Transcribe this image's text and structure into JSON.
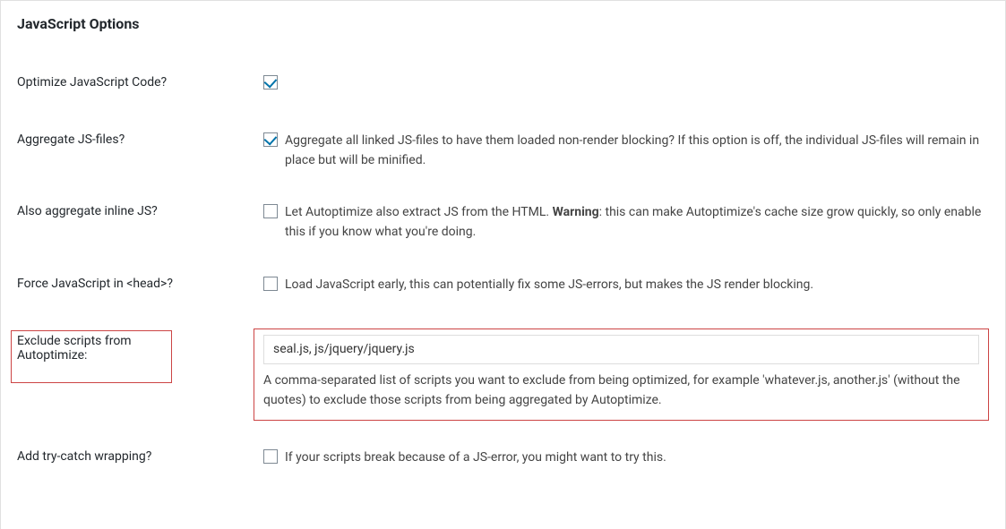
{
  "section": {
    "title": "JavaScript Options"
  },
  "rows": {
    "optimize": {
      "label": "Optimize JavaScript Code?",
      "checked": true
    },
    "aggregate": {
      "label": "Aggregate JS-files?",
      "checked": true,
      "desc": "Aggregate all linked JS-files to have them loaded non-render blocking? If this option is off, the individual JS-files will remain in place but will be minified."
    },
    "inline": {
      "label": "Also aggregate inline JS?",
      "checked": false,
      "desc_pre": "Let Autoptimize also extract JS from the HTML. ",
      "desc_bold": "Warning",
      "desc_post": ": this can make Autoptimize's cache size grow quickly, so only enable this if you know what you're doing."
    },
    "forcehead": {
      "label": "Force JavaScript in <head>?",
      "checked": false,
      "desc": "Load JavaScript early, this can potentially fix some JS-errors, but makes the JS render blocking."
    },
    "exclude": {
      "label": "Exclude scripts from Autoptimize:",
      "value": "seal.js, js/jquery/jquery.js",
      "hint": "A comma-separated list of scripts you want to exclude from being optimized, for example 'whatever.js, another.js' (without the quotes) to exclude those scripts from being aggregated by Autoptimize."
    },
    "trycatch": {
      "label": "Add try-catch wrapping?",
      "checked": false,
      "desc": "If your scripts break because of a JS-error, you might want to try this."
    }
  }
}
